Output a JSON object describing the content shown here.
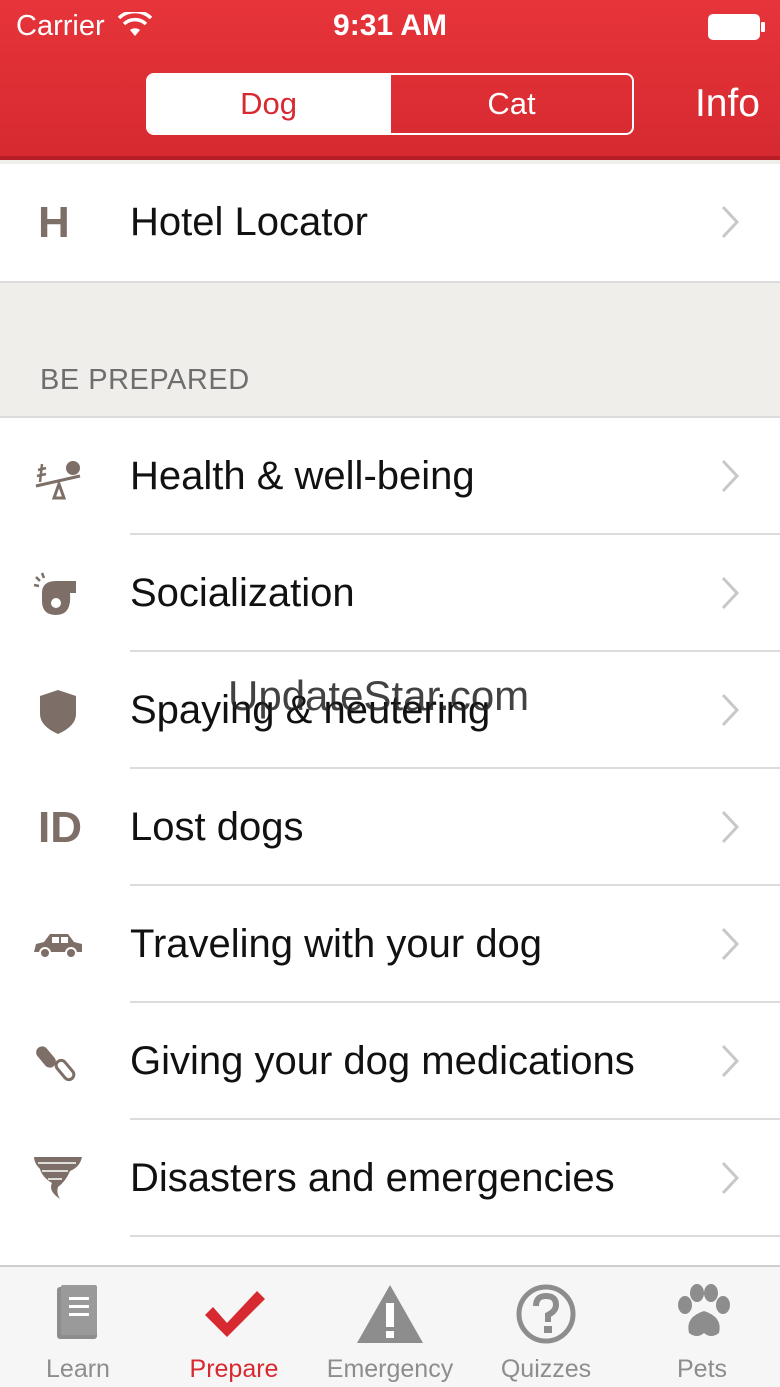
{
  "status_bar": {
    "carrier": "Carrier",
    "time": "9:31 AM"
  },
  "header": {
    "segments": [
      {
        "label": "Dog",
        "selected": true
      },
      {
        "label": "Cat",
        "selected": false
      }
    ],
    "info_label": "Info"
  },
  "hotel_row": {
    "icon": "H",
    "label": "Hotel Locator"
  },
  "section": {
    "title": "BE PREPARED"
  },
  "items": [
    {
      "label": "Health & well-being",
      "icon": "seesaw-icon"
    },
    {
      "label": "Socialization",
      "icon": "whistle-icon"
    },
    {
      "label": "Spaying & neutering",
      "icon": "shield-icon"
    },
    {
      "label": "Lost dogs",
      "icon": "id-icon",
      "icon_text": "ID"
    },
    {
      "label": "Traveling with your dog",
      "icon": "car-icon"
    },
    {
      "label": "Giving your dog medications",
      "icon": "pill-icon"
    },
    {
      "label": "Disasters and emergencies",
      "icon": "tornado-icon"
    }
  ],
  "watermark": "UpdateStar.com",
  "tabs": [
    {
      "label": "Learn",
      "icon": "book-icon",
      "active": false
    },
    {
      "label": "Prepare",
      "icon": "checkmark-icon",
      "active": true
    },
    {
      "label": "Emergency",
      "icon": "warning-icon",
      "active": false
    },
    {
      "label": "Quizzes",
      "icon": "question-icon",
      "active": false
    },
    {
      "label": "Pets",
      "icon": "paw-icon",
      "active": false
    }
  ],
  "colors": {
    "brand_red": "#d62a30",
    "icon_brown": "#7d6f67",
    "tab_gray": "#8d8d8d"
  }
}
